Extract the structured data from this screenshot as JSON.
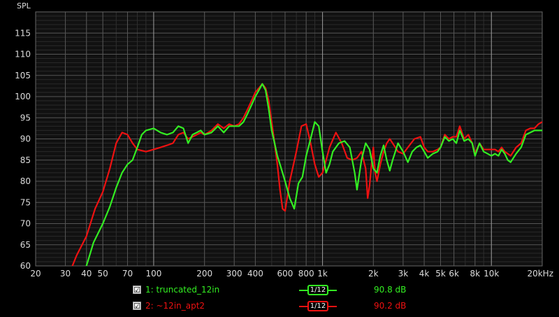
{
  "chart_data": {
    "type": "line",
    "ylabel": "SPL",
    "xscale": "log",
    "xlim": [
      20,
      20000
    ],
    "ylim": [
      60,
      120
    ],
    "grid": true,
    "x_ticks": [
      {
        "value": 20,
        "label": "20"
      },
      {
        "value": 30,
        "label": "30"
      },
      {
        "value": 40,
        "label": "40"
      },
      {
        "value": 50,
        "label": "50"
      },
      {
        "value": 70,
        "label": "70"
      },
      {
        "value": 100,
        "label": "100"
      },
      {
        "value": 200,
        "label": "200"
      },
      {
        "value": 300,
        "label": "300"
      },
      {
        "value": 400,
        "label": "400"
      },
      {
        "value": 600,
        "label": "600"
      },
      {
        "value": 800,
        "label": "800"
      },
      {
        "value": 1000,
        "label": "1k"
      },
      {
        "value": 2000,
        "label": "2k"
      },
      {
        "value": 3000,
        "label": "3k"
      },
      {
        "value": 4000,
        "label": "4k"
      },
      {
        "value": 5000,
        "label": "5k"
      },
      {
        "value": 6000,
        "label": "6k"
      },
      {
        "value": 8000,
        "label": "8k"
      },
      {
        "value": 10000,
        "label": "10k"
      },
      {
        "value": 20000,
        "label": "20kHz"
      }
    ],
    "y_ticks": [
      {
        "value": 60,
        "label": "60"
      },
      {
        "value": 65,
        "label": "65"
      },
      {
        "value": 70,
        "label": "70"
      },
      {
        "value": 75,
        "label": "75"
      },
      {
        "value": 80,
        "label": "80"
      },
      {
        "value": 85,
        "label": "85"
      },
      {
        "value": 90,
        "label": "90"
      },
      {
        "value": 95,
        "label": "95"
      },
      {
        "value": 100,
        "label": "100"
      },
      {
        "value": 105,
        "label": "105"
      },
      {
        "value": 110,
        "label": "110"
      },
      {
        "value": 115,
        "label": "115"
      }
    ],
    "series": [
      {
        "name": "1: truncated_12in",
        "color": "#33ee22",
        "smoothing": "1/12",
        "level": "90.8 dB",
        "points": [
          [
            40,
            60
          ],
          [
            44,
            65.5
          ],
          [
            50,
            70
          ],
          [
            55,
            74
          ],
          [
            60,
            78.5
          ],
          [
            65,
            82
          ],
          [
            70,
            84
          ],
          [
            75,
            85
          ],
          [
            80,
            88
          ],
          [
            85,
            91
          ],
          [
            90,
            92
          ],
          [
            100,
            92.5
          ],
          [
            110,
            91.5
          ],
          [
            120,
            91
          ],
          [
            130,
            91.5
          ],
          [
            140,
            93
          ],
          [
            150,
            92.5
          ],
          [
            160,
            89
          ],
          [
            170,
            91
          ],
          [
            180,
            91.5
          ],
          [
            190,
            92
          ],
          [
            200,
            91
          ],
          [
            220,
            91.5
          ],
          [
            240,
            93
          ],
          [
            260,
            91.5
          ],
          [
            280,
            93
          ],
          [
            300,
            93
          ],
          [
            320,
            93
          ],
          [
            340,
            94
          ],
          [
            360,
            96
          ],
          [
            380,
            98
          ],
          [
            400,
            100
          ],
          [
            420,
            101.5
          ],
          [
            440,
            103
          ],
          [
            460,
            101.5
          ],
          [
            480,
            97
          ],
          [
            500,
            92
          ],
          [
            520,
            89
          ],
          [
            540,
            86
          ],
          [
            560,
            84
          ],
          [
            600,
            80
          ],
          [
            640,
            76
          ],
          [
            680,
            73.5
          ],
          [
            720,
            79.5
          ],
          [
            760,
            81
          ],
          [
            800,
            86
          ],
          [
            850,
            90
          ],
          [
            900,
            94
          ],
          [
            950,
            93
          ],
          [
            1000,
            87
          ],
          [
            1050,
            82
          ],
          [
            1100,
            84
          ],
          [
            1150,
            87
          ],
          [
            1250,
            89
          ],
          [
            1350,
            89.5
          ],
          [
            1450,
            88
          ],
          [
            1550,
            82
          ],
          [
            1600,
            78
          ],
          [
            1700,
            85
          ],
          [
            1800,
            89
          ],
          [
            1900,
            87.5
          ],
          [
            2000,
            83
          ],
          [
            2100,
            82
          ],
          [
            2200,
            86
          ],
          [
            2300,
            88.5
          ],
          [
            2400,
            85
          ],
          [
            2500,
            82.5
          ],
          [
            2600,
            85
          ],
          [
            2700,
            87
          ],
          [
            2800,
            89
          ],
          [
            3000,
            87
          ],
          [
            3200,
            84.5
          ],
          [
            3400,
            87
          ],
          [
            3600,
            88
          ],
          [
            3800,
            88.5
          ],
          [
            4000,
            87
          ],
          [
            4200,
            85.5
          ],
          [
            4500,
            86.5
          ],
          [
            4800,
            87
          ],
          [
            5000,
            88
          ],
          [
            5300,
            90.5
          ],
          [
            5600,
            89.5
          ],
          [
            5900,
            90
          ],
          [
            6200,
            89
          ],
          [
            6500,
            92
          ],
          [
            6900,
            89.5
          ],
          [
            7300,
            90
          ],
          [
            7700,
            89
          ],
          [
            8000,
            86
          ],
          [
            8500,
            89
          ],
          [
            9000,
            87
          ],
          [
            9500,
            86.5
          ],
          [
            10000,
            86
          ],
          [
            10500,
            86.5
          ],
          [
            11000,
            86
          ],
          [
            11500,
            87.5
          ],
          [
            12000,
            86.5
          ],
          [
            12500,
            85
          ],
          [
            13000,
            84.5
          ],
          [
            14000,
            86.5
          ],
          [
            15000,
            88
          ],
          [
            16000,
            91
          ],
          [
            17000,
            91.5
          ],
          [
            18000,
            92
          ],
          [
            19000,
            92
          ],
          [
            20000,
            92
          ]
        ]
      },
      {
        "name": "2: ~12in_apt2",
        "color": "#ee1111",
        "smoothing": "1/12",
        "level": "90.2 dB",
        "points": [
          [
            33,
            60
          ],
          [
            35,
            62.5
          ],
          [
            40,
            67
          ],
          [
            45,
            73.5
          ],
          [
            50,
            77.5
          ],
          [
            55,
            83
          ],
          [
            60,
            89
          ],
          [
            65,
            91.5
          ],
          [
            70,
            91
          ],
          [
            75,
            89
          ],
          [
            80,
            87.5
          ],
          [
            90,
            87
          ],
          [
            100,
            87.5
          ],
          [
            110,
            88
          ],
          [
            120,
            88.5
          ],
          [
            130,
            89
          ],
          [
            140,
            91
          ],
          [
            150,
            91.5
          ],
          [
            160,
            90
          ],
          [
            170,
            90.5
          ],
          [
            180,
            91
          ],
          [
            190,
            91.5
          ],
          [
            200,
            91
          ],
          [
            220,
            92
          ],
          [
            240,
            93.5
          ],
          [
            260,
            92.5
          ],
          [
            280,
            93.5
          ],
          [
            300,
            93
          ],
          [
            320,
            93.5
          ],
          [
            340,
            95
          ],
          [
            360,
            97
          ],
          [
            380,
            99
          ],
          [
            400,
            101
          ],
          [
            420,
            102
          ],
          [
            440,
            103
          ],
          [
            460,
            102
          ],
          [
            480,
            99
          ],
          [
            500,
            94
          ],
          [
            520,
            89
          ],
          [
            540,
            84
          ],
          [
            560,
            78
          ],
          [
            580,
            73.5
          ],
          [
            600,
            73
          ],
          [
            640,
            80
          ],
          [
            700,
            87
          ],
          [
            750,
            93
          ],
          [
            800,
            93.5
          ],
          [
            850,
            89
          ],
          [
            900,
            84
          ],
          [
            950,
            81
          ],
          [
            1000,
            82
          ],
          [
            1050,
            85
          ],
          [
            1100,
            88
          ],
          [
            1200,
            91.5
          ],
          [
            1300,
            89
          ],
          [
            1400,
            85.5
          ],
          [
            1500,
            85
          ],
          [
            1600,
            85.5
          ],
          [
            1700,
            87
          ],
          [
            1800,
            83
          ],
          [
            1850,
            76
          ],
          [
            1900,
            79
          ],
          [
            1950,
            84
          ],
          [
            2000,
            88
          ],
          [
            2050,
            82
          ],
          [
            2100,
            80
          ],
          [
            2200,
            84
          ],
          [
            2300,
            87
          ],
          [
            2400,
            89
          ],
          [
            2500,
            90
          ],
          [
            2600,
            89
          ],
          [
            2700,
            88
          ],
          [
            2800,
            87
          ],
          [
            3000,
            86.5
          ],
          [
            3200,
            88
          ],
          [
            3500,
            90
          ],
          [
            3800,
            90.5
          ],
          [
            4000,
            88
          ],
          [
            4200,
            87
          ],
          [
            4500,
            87
          ],
          [
            4800,
            87.5
          ],
          [
            5000,
            88
          ],
          [
            5300,
            91
          ],
          [
            5600,
            90
          ],
          [
            5900,
            90.5
          ],
          [
            6200,
            90.5
          ],
          [
            6500,
            93
          ],
          [
            6900,
            90
          ],
          [
            7300,
            91
          ],
          [
            7700,
            89
          ],
          [
            8000,
            86.5
          ],
          [
            8500,
            89
          ],
          [
            9000,
            87.5
          ],
          [
            9500,
            87.5
          ],
          [
            10000,
            87.5
          ],
          [
            10500,
            87.5
          ],
          [
            11000,
            87
          ],
          [
            11500,
            88
          ],
          [
            12000,
            87
          ],
          [
            12500,
            86.5
          ],
          [
            13000,
            86
          ],
          [
            14000,
            88
          ],
          [
            15000,
            89
          ],
          [
            16000,
            92
          ],
          [
            17000,
            92.5
          ],
          [
            18000,
            92.5
          ],
          [
            19000,
            93.5
          ],
          [
            20000,
            94
          ]
        ]
      }
    ]
  },
  "legend": [
    {
      "label": "1: truncated_12in",
      "checked": "☑",
      "smoothing": "1/12",
      "level": "90.8 dB",
      "color": "#33ee22"
    },
    {
      "label": "2: ~12in_apt2",
      "checked": "☑",
      "smoothing": "1/12",
      "level": "90.2 dB",
      "color": "#ee1111"
    }
  ]
}
